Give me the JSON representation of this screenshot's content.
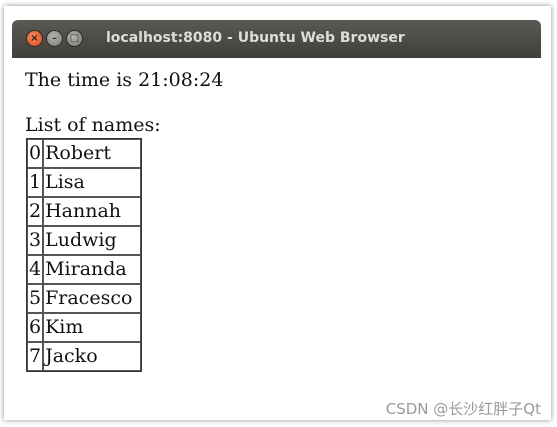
{
  "window": {
    "title": "localhost:8080 - Ubuntu Web Browser",
    "controls": {
      "close_glyph": "×",
      "minimize_glyph": "–",
      "maximize_glyph": "□"
    }
  },
  "page": {
    "time_text": "The time is 21:08:24",
    "list_title": "List of names:",
    "names": [
      {
        "index": "0",
        "name": "Robert"
      },
      {
        "index": "1",
        "name": "Lisa"
      },
      {
        "index": "2",
        "name": "Hannah"
      },
      {
        "index": "3",
        "name": "Ludwig"
      },
      {
        "index": "4",
        "name": "Miranda"
      },
      {
        "index": "5",
        "name": "Fracesco"
      },
      {
        "index": "6",
        "name": "Kim"
      },
      {
        "index": "7",
        "name": "Jacko"
      }
    ]
  },
  "watermark": "CSDN @长沙红胖子Qt"
}
